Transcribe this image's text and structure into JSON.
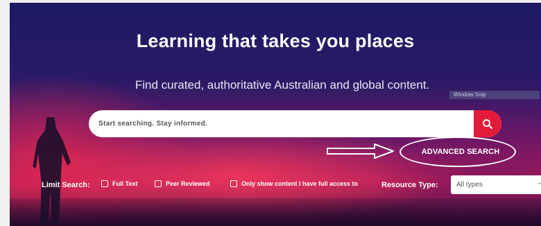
{
  "hero": {
    "title": "Learning that takes you places",
    "subtitle": "Find curated, authoritative Australian and global content."
  },
  "overlay": {
    "snip_label": "Window Snip"
  },
  "search": {
    "placeholder": "Start searching. Stay informed.",
    "button_icon": "search-icon",
    "accent_color": "#e31b3a"
  },
  "advanced_search": {
    "label": "ADVANCED SEARCH"
  },
  "filters": {
    "limit_label": "Limit Search:",
    "options": [
      {
        "label": "Full Text",
        "checked": false
      },
      {
        "label": "Peer Reviewed",
        "checked": false
      },
      {
        "label": "Only show content I have full access to",
        "checked": false
      }
    ],
    "resource_type_label": "Resource Type:",
    "resource_type_value": "All types"
  }
}
